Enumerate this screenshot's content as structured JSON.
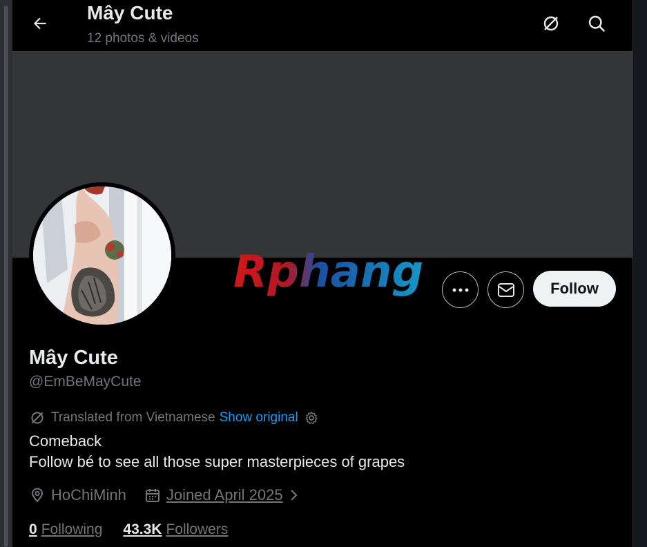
{
  "header": {
    "title": "Mây Cute",
    "subtitle": "12 photos & videos"
  },
  "watermark": {
    "text": "Rphang"
  },
  "actions": {
    "follow_label": "Follow"
  },
  "profile": {
    "display_name": "Mây Cute",
    "handle": "@EmBeMayCute",
    "translated_from": "Translated from Vietnamese",
    "show_original": "Show original",
    "bio_line1": "Comeback",
    "bio_line2": "Follow bé to see all those super masterpieces of grapes",
    "location": "HoChiMinh",
    "joined": "Joined April 2025"
  },
  "stats": {
    "following_count": "0",
    "following_label": "Following",
    "followers_count": "43.3K",
    "followers_label": "Followers"
  },
  "colors": {
    "background": "#000000",
    "banner": "#333639",
    "link": "#1d9bf0",
    "muted": "#71767b",
    "text": "#e7e9ea",
    "follow_button": "#eff3f4"
  },
  "icons": [
    "back-arrow-icon",
    "translate-icon",
    "search-icon",
    "more-icon",
    "mail-icon",
    "gear-icon",
    "location-pin-icon",
    "calendar-icon",
    "chevron-right-icon"
  ]
}
